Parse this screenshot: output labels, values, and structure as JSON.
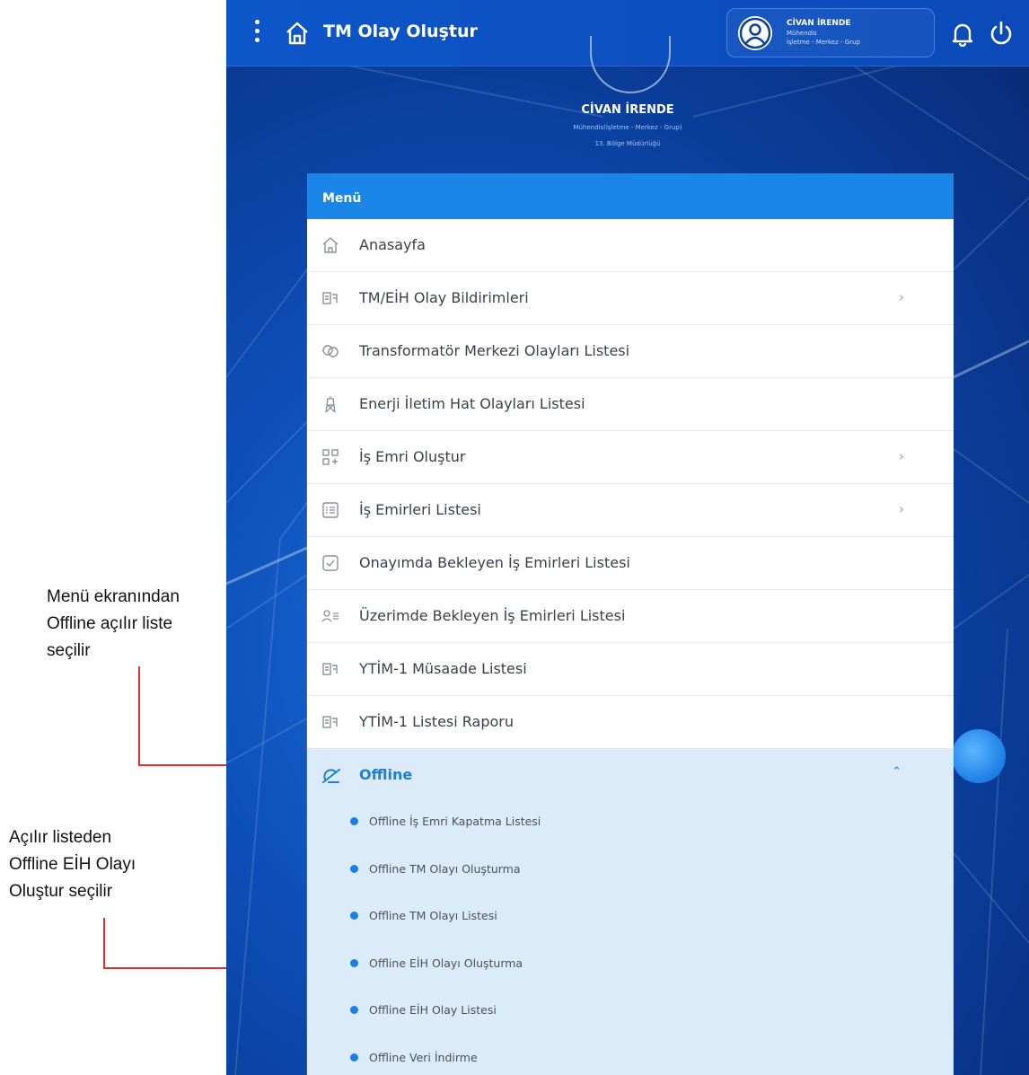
{
  "annotations": {
    "note1": [
      "Menü ekranından",
      "Offline  açılır liste",
      "seçilir"
    ],
    "note2": [
      "Açılır listeden",
      "Offline EİH Olayı",
      "Oluştur seçilir"
    ],
    "line_color": "#e03030"
  },
  "topbar": {
    "title": "TM Olay Oluştur",
    "menu_icon": "kebab-icon",
    "home_icon": "home-icon",
    "bell_icon": "bell-icon",
    "power_icon": "power-icon"
  },
  "user": {
    "name": "CİVAN İRENDE",
    "role": "Mühendis",
    "unit": "İşletme - Merkez - Grup"
  },
  "profile": {
    "name": "CİVAN İRENDE",
    "role_line": "Mühendis(İşletme - Merkez - Grup)",
    "dept_line": "13. Bölge Müdürlüğü"
  },
  "menu": {
    "header": "Menü",
    "items": [
      {
        "label": "Anasayfa",
        "icon": "home-icon",
        "chevron": ""
      },
      {
        "label": "TM/EİH Olay Bildirimleri",
        "icon": "report-icon",
        "chevron": "›"
      },
      {
        "label": "Transformatör Merkezi Olayları Listesi",
        "icon": "transformer-icon",
        "chevron": ""
      },
      {
        "label": "Enerji İletim Hat Olayları Listesi",
        "icon": "tower-icon",
        "chevron": ""
      },
      {
        "label": "İş Emri Oluştur",
        "icon": "grid-add-icon",
        "chevron": "›"
      },
      {
        "label": "İş Emirleri Listesi",
        "icon": "list-icon",
        "chevron": "›"
      },
      {
        "label": "Onayımda Bekleyen İş Emirleri Listesi",
        "icon": "approval-icon",
        "chevron": ""
      },
      {
        "label": "Üzerimde Bekleyen İş Emirleri Listesi",
        "icon": "user-list-icon",
        "chevron": ""
      },
      {
        "label": "YTİM-1 Müsaade Listesi",
        "icon": "report-icon",
        "chevron": ""
      },
      {
        "label": "YTİM-1 Listesi Raporu",
        "icon": "report-icon",
        "chevron": ""
      }
    ],
    "offline": {
      "label": "Offline",
      "icon": "offline-icon",
      "chevron": "⌃",
      "subitems": [
        "Offline İş Emri Kapatma Listesi",
        "Offline TM Olayı Oluşturma",
        "Offline TM Olayı Listesi",
        "Offline EİH Olayı Oluşturma",
        "Offline EİH Olay Listesi",
        "Offline Veri İndirme"
      ]
    }
  },
  "colors": {
    "primary": "#1a86e8",
    "topbar": "#0d56c9",
    "offline_bg": "#dcebfa",
    "accent_text": "#1a7fe0"
  }
}
